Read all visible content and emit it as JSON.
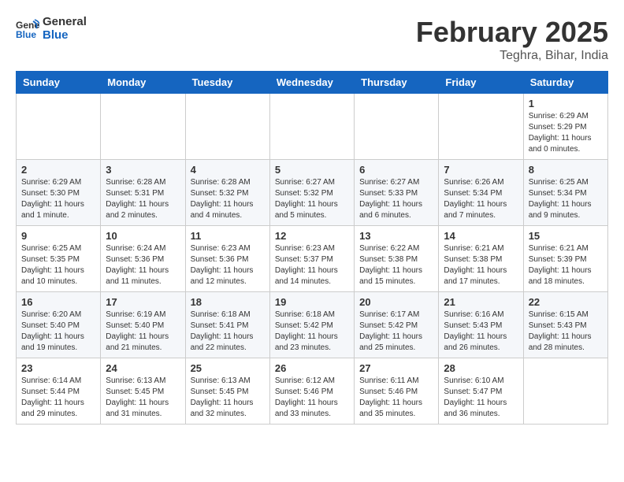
{
  "logo": {
    "line1": "General",
    "line2": "Blue"
  },
  "title": "February 2025",
  "location": "Teghra, Bihar, India",
  "days_of_week": [
    "Sunday",
    "Monday",
    "Tuesday",
    "Wednesday",
    "Thursday",
    "Friday",
    "Saturday"
  ],
  "weeks": [
    [
      {
        "day": "",
        "info": ""
      },
      {
        "day": "",
        "info": ""
      },
      {
        "day": "",
        "info": ""
      },
      {
        "day": "",
        "info": ""
      },
      {
        "day": "",
        "info": ""
      },
      {
        "day": "",
        "info": ""
      },
      {
        "day": "1",
        "info": "Sunrise: 6:29 AM\nSunset: 5:29 PM\nDaylight: 11 hours\nand 0 minutes."
      }
    ],
    [
      {
        "day": "2",
        "info": "Sunrise: 6:29 AM\nSunset: 5:30 PM\nDaylight: 11 hours\nand 1 minute."
      },
      {
        "day": "3",
        "info": "Sunrise: 6:28 AM\nSunset: 5:31 PM\nDaylight: 11 hours\nand 2 minutes."
      },
      {
        "day": "4",
        "info": "Sunrise: 6:28 AM\nSunset: 5:32 PM\nDaylight: 11 hours\nand 4 minutes."
      },
      {
        "day": "5",
        "info": "Sunrise: 6:27 AM\nSunset: 5:32 PM\nDaylight: 11 hours\nand 5 minutes."
      },
      {
        "day": "6",
        "info": "Sunrise: 6:27 AM\nSunset: 5:33 PM\nDaylight: 11 hours\nand 6 minutes."
      },
      {
        "day": "7",
        "info": "Sunrise: 6:26 AM\nSunset: 5:34 PM\nDaylight: 11 hours\nand 7 minutes."
      },
      {
        "day": "8",
        "info": "Sunrise: 6:25 AM\nSunset: 5:34 PM\nDaylight: 11 hours\nand 9 minutes."
      }
    ],
    [
      {
        "day": "9",
        "info": "Sunrise: 6:25 AM\nSunset: 5:35 PM\nDaylight: 11 hours\nand 10 minutes."
      },
      {
        "day": "10",
        "info": "Sunrise: 6:24 AM\nSunset: 5:36 PM\nDaylight: 11 hours\nand 11 minutes."
      },
      {
        "day": "11",
        "info": "Sunrise: 6:23 AM\nSunset: 5:36 PM\nDaylight: 11 hours\nand 12 minutes."
      },
      {
        "day": "12",
        "info": "Sunrise: 6:23 AM\nSunset: 5:37 PM\nDaylight: 11 hours\nand 14 minutes."
      },
      {
        "day": "13",
        "info": "Sunrise: 6:22 AM\nSunset: 5:38 PM\nDaylight: 11 hours\nand 15 minutes."
      },
      {
        "day": "14",
        "info": "Sunrise: 6:21 AM\nSunset: 5:38 PM\nDaylight: 11 hours\nand 17 minutes."
      },
      {
        "day": "15",
        "info": "Sunrise: 6:21 AM\nSunset: 5:39 PM\nDaylight: 11 hours\nand 18 minutes."
      }
    ],
    [
      {
        "day": "16",
        "info": "Sunrise: 6:20 AM\nSunset: 5:40 PM\nDaylight: 11 hours\nand 19 minutes."
      },
      {
        "day": "17",
        "info": "Sunrise: 6:19 AM\nSunset: 5:40 PM\nDaylight: 11 hours\nand 21 minutes."
      },
      {
        "day": "18",
        "info": "Sunrise: 6:18 AM\nSunset: 5:41 PM\nDaylight: 11 hours\nand 22 minutes."
      },
      {
        "day": "19",
        "info": "Sunrise: 6:18 AM\nSunset: 5:42 PM\nDaylight: 11 hours\nand 23 minutes."
      },
      {
        "day": "20",
        "info": "Sunrise: 6:17 AM\nSunset: 5:42 PM\nDaylight: 11 hours\nand 25 minutes."
      },
      {
        "day": "21",
        "info": "Sunrise: 6:16 AM\nSunset: 5:43 PM\nDaylight: 11 hours\nand 26 minutes."
      },
      {
        "day": "22",
        "info": "Sunrise: 6:15 AM\nSunset: 5:43 PM\nDaylight: 11 hours\nand 28 minutes."
      }
    ],
    [
      {
        "day": "23",
        "info": "Sunrise: 6:14 AM\nSunset: 5:44 PM\nDaylight: 11 hours\nand 29 minutes."
      },
      {
        "day": "24",
        "info": "Sunrise: 6:13 AM\nSunset: 5:45 PM\nDaylight: 11 hours\nand 31 minutes."
      },
      {
        "day": "25",
        "info": "Sunrise: 6:13 AM\nSunset: 5:45 PM\nDaylight: 11 hours\nand 32 minutes."
      },
      {
        "day": "26",
        "info": "Sunrise: 6:12 AM\nSunset: 5:46 PM\nDaylight: 11 hours\nand 33 minutes."
      },
      {
        "day": "27",
        "info": "Sunrise: 6:11 AM\nSunset: 5:46 PM\nDaylight: 11 hours\nand 35 minutes."
      },
      {
        "day": "28",
        "info": "Sunrise: 6:10 AM\nSunset: 5:47 PM\nDaylight: 11 hours\nand 36 minutes."
      },
      {
        "day": "",
        "info": ""
      }
    ]
  ]
}
